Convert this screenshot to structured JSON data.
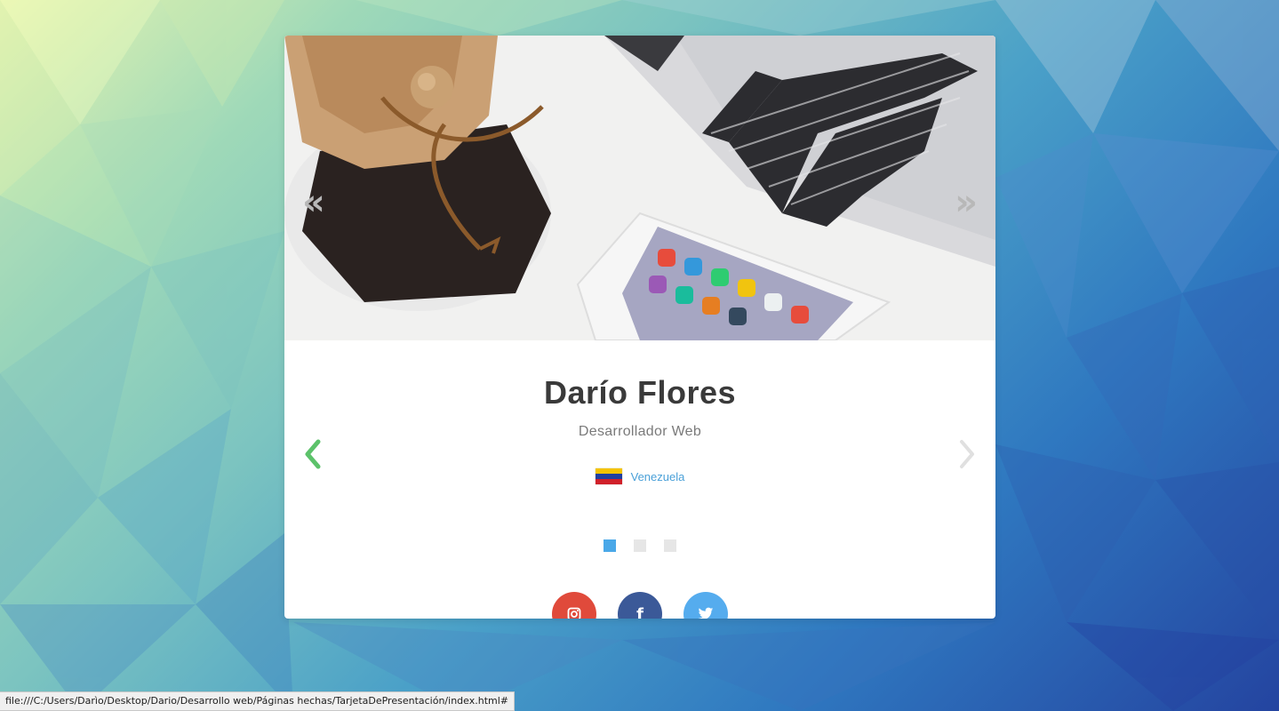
{
  "colors": {
    "accent_green": "#5cc26a",
    "dot_active": "#4aa8e8",
    "instagram": "#e04a3b",
    "facebook": "#3b5998",
    "twitter": "#55acee",
    "name_text": "#3a3a3a",
    "country_link": "#4aa0d8"
  },
  "hero": {
    "prev_symbol": "«",
    "next_symbol": "»",
    "image_icon": "coffee-laptop-phone-photo"
  },
  "profile": {
    "name": "Darío Flores",
    "role": "Desarrollador Web",
    "country": "Venezuela",
    "flag_icon": "venezuela-flag-icon"
  },
  "carousel": {
    "active_index": 0,
    "count": 3
  },
  "social": {
    "instagram_icon": "instagram-icon",
    "facebook_label": "f",
    "twitter_icon": "twitter-icon"
  },
  "status_bar": {
    "url": "file:///C:/Users/Darìo/Desktop/Dario/Desarrollo web/Páginas hechas/TarjetaDePresentación/index.html#"
  }
}
